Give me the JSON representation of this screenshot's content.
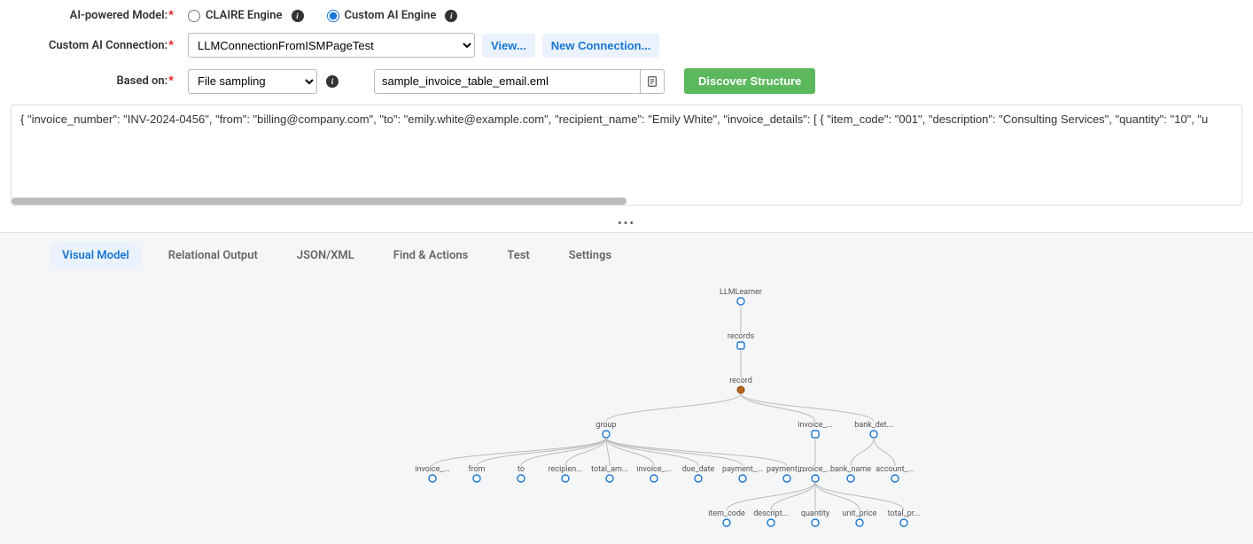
{
  "form": {
    "model_label": "AI-powered Model:",
    "claire_label": "CLAIRE Engine",
    "custom_label": "Custom AI Engine",
    "connection_label": "Custom AI Connection:",
    "connection_value": "LLMConnectionFromISMPageTest",
    "view_btn": "View...",
    "new_conn_btn": "New Connection...",
    "based_on_label": "Based on:",
    "based_on_value": "File sampling",
    "sample_file": "sample_invoice_table_email.eml",
    "discover_btn": "Discover Structure"
  },
  "json_preview": "{  \"invoice_number\": \"INV-2024-0456\",  \"from\": \"billing@company.com\",  \"to\": \"emily.white@example.com\",  \"recipient_name\": \"Emily White\",  \"invoice_details\": [    {      \"item_code\": \"001\",      \"description\": \"Consulting Services\",      \"quantity\": \"10\",      \"u",
  "tabs": {
    "visual_model": "Visual Model",
    "relational_output": "Relational Output",
    "json_xml": "JSON/XML",
    "find_actions": "Find & Actions",
    "test": "Test",
    "settings": "Settings"
  },
  "tree": {
    "root": "LLMLearner",
    "l1": "records",
    "l2": "record",
    "l3a": "group",
    "l3b": "invoice_...",
    "l3c": "bank_det...",
    "group_children": [
      "invoice_...",
      "from",
      "to",
      "recipien...",
      "total_am...",
      "invoice_...",
      "due_date",
      "payment_...",
      "payment_..."
    ],
    "invoice_children_root": "invoice_...",
    "invoice_leaves": [
      "item_code",
      "descript...",
      "quantity",
      "unit_price",
      "total_pr..."
    ],
    "bank_children": [
      "bank_name",
      "account_..."
    ]
  }
}
